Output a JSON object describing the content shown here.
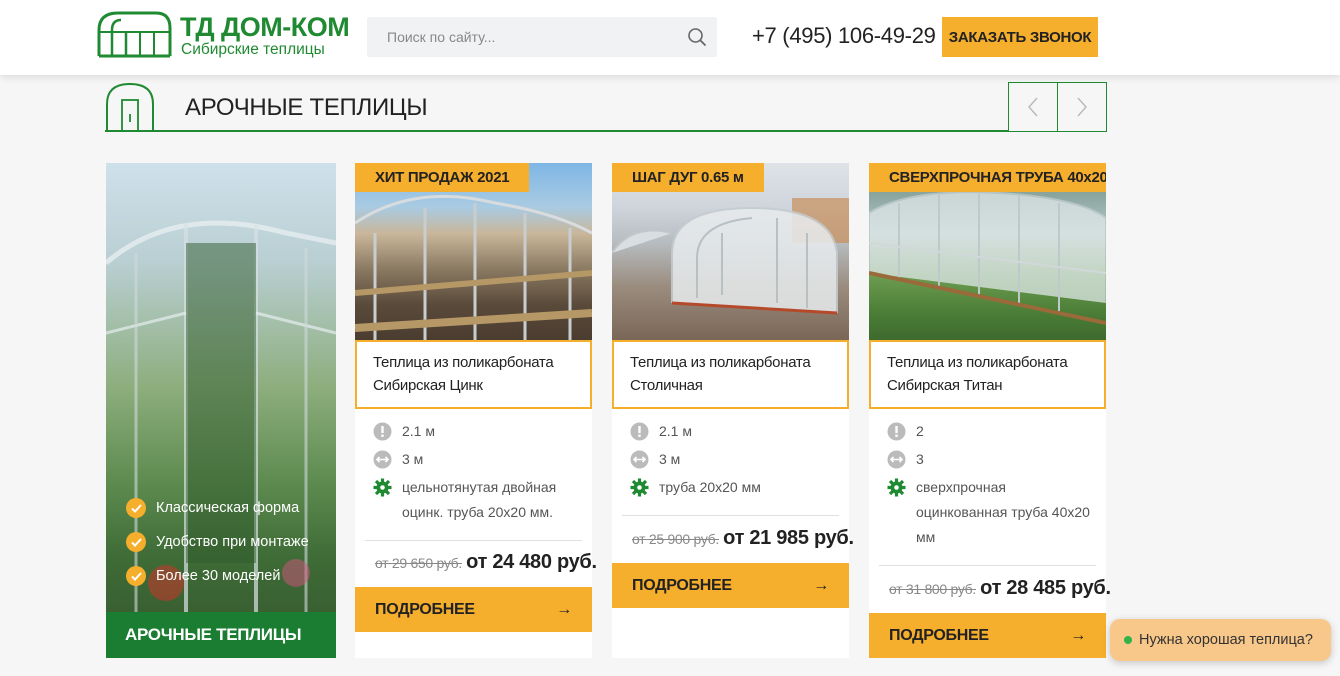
{
  "header": {
    "logo_title": "ТД ДОМ-КОМ",
    "logo_subtitle": "Сибирские теплицы",
    "search_placeholder": "Поиск по сайту...",
    "phone": "+7 (495) 106-49-29",
    "callback_label": "ЗАКАЗАТЬ ЗВОНОК"
  },
  "section": {
    "title": "АРОЧНЫЕ ТЕПЛИЦЫ"
  },
  "promo": {
    "features": [
      "Классическая форма",
      "Удобство при монтаже",
      "Более 30 моделей"
    ],
    "label": "АРОЧНЫЕ ТЕПЛИЦЫ"
  },
  "products": [
    {
      "badge": "ХИТ ПРОДАЖ 2021",
      "title_line1": "Теплица из поликарбоната",
      "title_line2": "Сибирская Цинк",
      "width": "2.1 м",
      "length": "3 м",
      "frame": "цельнотянутая двойная оцинк. труба 20х20 мм.",
      "old_price": "от 29 650 руб.",
      "new_price": "от 24 480 руб.",
      "more_label": "ПОДРОБНЕЕ"
    },
    {
      "badge": "ШАГ ДУГ 0.65 м",
      "title_line1": "Теплица из поликарбоната",
      "title_line2": "Столичная",
      "width": "2.1 м",
      "length": "3 м",
      "frame": "труба 20х20 мм",
      "old_price": "от 25 900 руб.",
      "new_price": "от 21 985 руб.",
      "more_label": "ПОДРОБНЕЕ"
    },
    {
      "badge": "СВЕРХПРОЧНАЯ ТРУБА 40х20",
      "title_line1": "Теплица из поликарбоната",
      "title_line2": "Сибирская Титан",
      "width": "2",
      "length": "3",
      "frame": "сверхпрочная оцинкованная труба 40х20 мм",
      "old_price": "от 31 800 руб.",
      "new_price": "от 28 485 руб.",
      "more_label": "ПОДРОБНЕЕ"
    }
  ],
  "chat": {
    "label": "Нужна хорошая теплица?"
  },
  "colors": {
    "brand_green": "#1f8a32",
    "accent_orange": "#f6ae2d"
  }
}
